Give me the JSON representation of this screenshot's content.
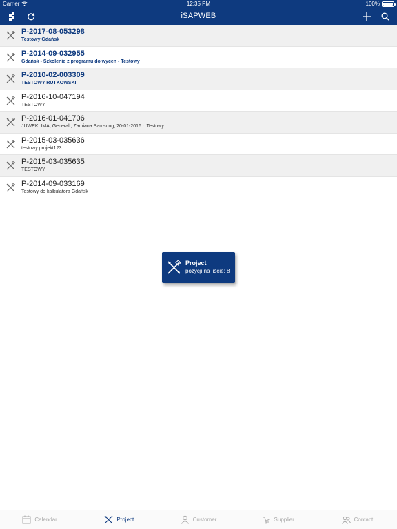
{
  "status_bar": {
    "carrier": "Carrier",
    "time": "12:35 PM",
    "battery": "100%"
  },
  "nav": {
    "title": "iSAPWEB"
  },
  "projects": [
    {
      "code": "P-2017-08-053298",
      "desc": "Testowy Gdańsk",
      "highlight": true
    },
    {
      "code": "P-2014-09-032955",
      "desc": "Gdańsk - Szkolenie z programu do wycen - Testowy",
      "highlight": true
    },
    {
      "code": "P-2010-02-003309",
      "desc": "TESTOWY RUTKOWSKI",
      "highlight": true
    },
    {
      "code": "P-2016-10-047194",
      "desc": "TESTOWY",
      "highlight": false
    },
    {
      "code": "P-2016-01-041706",
      "desc": "JUWEKLIMA, General , Zamiana Samsung, 20-01-2016 r. Testowy",
      "highlight": false
    },
    {
      "code": "P-2015-03-035636",
      "desc": "testowy projekt123",
      "highlight": false
    },
    {
      "code": "P-2015-03-035635",
      "desc": "TESTOWY",
      "highlight": false
    },
    {
      "code": "P-2014-09-033169",
      "desc": "Testowy do kalkulatora Gdańsk",
      "highlight": false
    }
  ],
  "toast": {
    "title": "Project",
    "subtitle": "pozycji na liście: 8"
  },
  "tabs": [
    {
      "label": "Calendar",
      "icon": "calendar-icon",
      "active": false
    },
    {
      "label": "Project",
      "icon": "project-tools-icon",
      "active": true
    },
    {
      "label": "Customer",
      "icon": "customer-icon",
      "active": false
    },
    {
      "label": "Supplier",
      "icon": "supplier-icon",
      "active": false
    },
    {
      "label": "Contact",
      "icon": "contact-icon",
      "active": false
    }
  ],
  "colors": {
    "accent": "#0e3a7f",
    "row_alt": "#f0f0f0",
    "tab_inactive": "#a9a9a9"
  }
}
